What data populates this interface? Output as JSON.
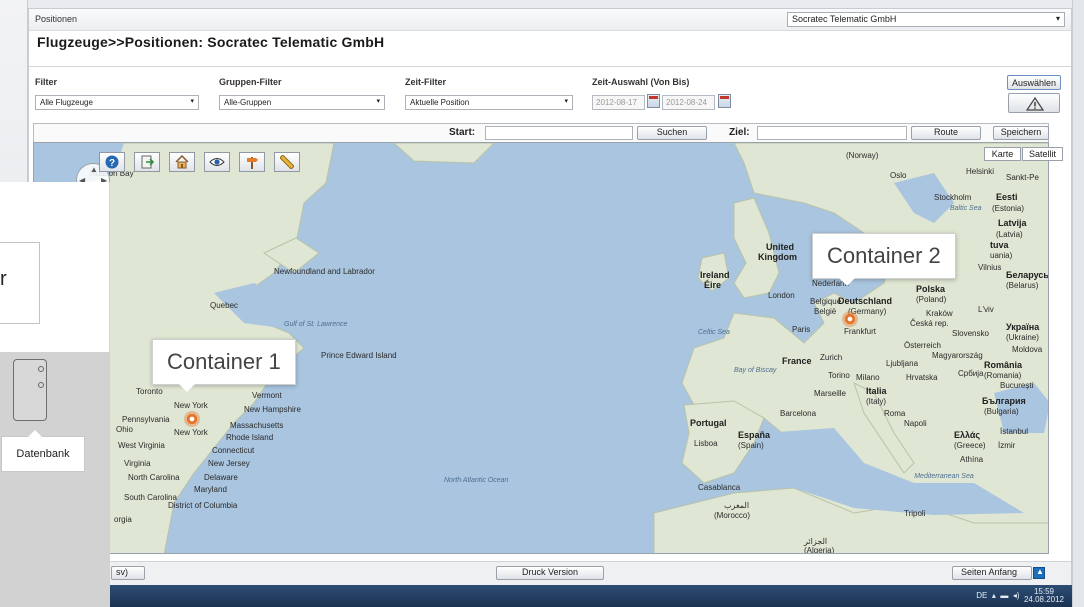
{
  "window": {
    "title": "Positionen",
    "heading": "Flugzeuge>>Positionen: Socratec Telematic GmbH"
  },
  "company_select": {
    "value": "Socratec Telematic GmbH"
  },
  "filters": {
    "filter_label": "Filter",
    "filter_value": "Alle Flugzeuge",
    "group_label": "Gruppen-Filter",
    "group_value": "Alle-Gruppen",
    "time_label": "Zeit-Filter",
    "time_value": "Aktuelle Position",
    "range_label": "Zeit-Auswahl (Von Bis)",
    "date_from": "2012-08-17",
    "date_to": "2012-08-24",
    "select_button": "Auswählen"
  },
  "route": {
    "start_label": "Start:",
    "search_button": "Suchen",
    "dest_label": "Ziel:",
    "route_button": "Route",
    "save_button": "Speichern"
  },
  "map": {
    "type_map": "Karte",
    "type_satellite": "Satellit",
    "callout_1": "Container 1",
    "callout_2": "Container 2",
    "labels": {
      "norway": "(Norway)",
      "oslo": "Oslo",
      "helsinki": "Helsinki",
      "sankt": "Sankt-Pe",
      "stockholm": "Stockholm",
      "eesti": "Eesti",
      "estonia": "(Estonia)",
      "baltic": "Baltic Sea",
      "latvija": "Latvija",
      "latvia": "(Latvia)",
      "lietuva": "tuva",
      "lithuania": "uania)",
      "vilnius": "Vilnius",
      "uk1": "United",
      "uk2": "Kingdom",
      "ireland1": "Ireland",
      "ireland2": "Éire",
      "london": "London",
      "netherlands": "Nederland",
      "belgique": "Belgique",
      "belgie": "België",
      "deutschland": "Deutschland",
      "germany": "(Germany)",
      "polska": "Polska",
      "poland": "(Poland)",
      "belarus1": "Беларусь",
      "belarus2": "(Belarus)",
      "krakow": "Kraków",
      "lviv": "L'viv",
      "celtic": "Celtic Sea",
      "paris": "Paris",
      "frankfurt": "Frankfurt",
      "cesko": "Česká rep.",
      "slovensko": "Slovensko",
      "ukraina1": "Україна",
      "ukraina2": "(Ukraine)",
      "osterreich": "Österreich",
      "hungary": "Magyarország",
      "moldova": "Moldova",
      "france": "France",
      "zurich": "Zurich",
      "ljubljana": "Ljubljana",
      "romania1": "România",
      "romania2": "(Romania)",
      "biscay": "Bay of Biscay",
      "torino": "Torino",
      "milano": "Milano",
      "hrvatska": "Hrvatska",
      "srbija": "Србија",
      "bucuresti": "București",
      "marseille": "Marseille",
      "italia1": "Italia",
      "italia2": "(Italy)",
      "bulgaria1": "България",
      "bulgaria2": "(Bulgaria)",
      "barcelona": "Barcelona",
      "roma": "Roma",
      "napoli": "Napoli",
      "istanbul": "İstanbul",
      "portugal": "Portugal",
      "lisboa": "Lisboa",
      "espana1": "España",
      "espana2": "(Spain)",
      "greece1": "Ελλάς",
      "greece2": "(Greece)",
      "izmir": "İzmir",
      "athina": "Athína",
      "med": "Mediterranean Sea",
      "casablanca": "Casablanca",
      "morocco1": "المغرب",
      "morocco2": "(Morocco)",
      "tripoli": "Tripoli",
      "algeria1": "الجزائر",
      "algeria2": "(Algeria)",
      "atlantic": "North Atlantic Ocean",
      "newfoundland": "Newfoundland and Labrador",
      "quebec": "Quebec",
      "gulf": "Gulf of St. Lawrence",
      "pei": "Prince Edward Island",
      "toronto": "Toronto",
      "newyork_state": "New York",
      "vermont": "Vermont",
      "newhampshire": "New Hampshire",
      "massachusetts": "Massachusetts",
      "rhodeisland": "Rhode Island",
      "connecticut": "Connecticut",
      "pennsylvania": "Pennsylvania",
      "newyork_city": "New York",
      "newjersey": "New Jersey",
      "ohio": "Ohio",
      "westvirginia": "West Virginia",
      "virginia": "Virginia",
      "delaware": "Delaware",
      "maryland": "Maryland",
      "northcarolina": "North Carolina",
      "southcarolina": "South Carolina",
      "georgia": "orgia",
      "dc": "District of Columbia",
      "hudson": "Hudson Bay"
    }
  },
  "footer": {
    "csv": "sv)",
    "print_button": "Druck Version",
    "top_button": "Seiten Anfang"
  },
  "overlay": {
    "box_text": "r",
    "db_label": "Datenbank"
  },
  "taskbar": {
    "lang": "DE",
    "time": "15:59",
    "date": "24.08.2012"
  },
  "colors": {
    "water": "#a9c5df",
    "land": "#dfe6d3",
    "marker": "#e6742c",
    "accent": "#1e6fb8"
  },
  "icons": [
    "help-icon",
    "export-icon",
    "home-icon",
    "view-icon",
    "signpost-icon",
    "ruler-icon",
    "warning-icon",
    "calendar-icon",
    "database-icon"
  ]
}
